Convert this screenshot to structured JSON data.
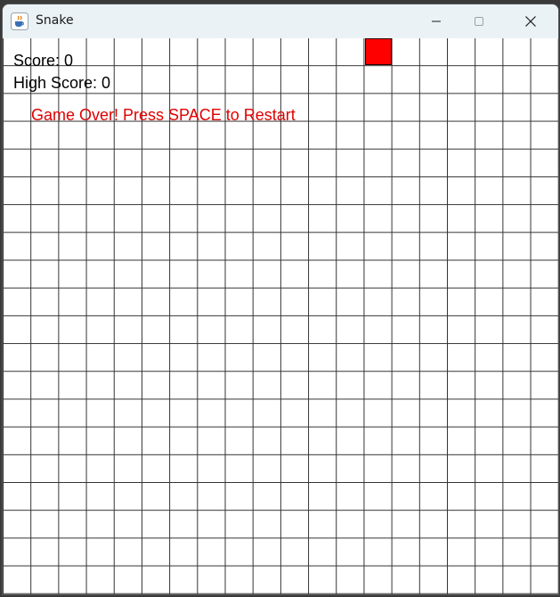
{
  "window": {
    "title": "Snake",
    "app_icon": "java-coffee-cup-icon",
    "controls": {
      "minimize_icon": "minimize-icon",
      "maximize_icon": "maximize-icon",
      "close_icon": "close-icon"
    }
  },
  "game": {
    "score_text": "Score: 0",
    "high_score_text": "High Score: 0",
    "status_text": "Game Over! Press SPACE to Restart",
    "score": 0,
    "high_score": 0,
    "grid": {
      "columns": 20,
      "rows": 20
    },
    "food": {
      "column": 13,
      "row": 0
    }
  },
  "colors": {
    "food": "#ff0000",
    "status_text": "#e00000",
    "grid_line": "#333333",
    "background": "#ffffff"
  }
}
